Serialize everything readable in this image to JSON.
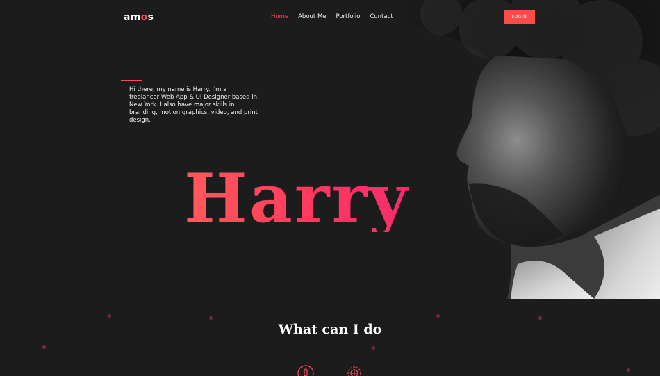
{
  "nav": {
    "logo_prefix": "am",
    "logo_accent": "o",
    "logo_suffix": "s",
    "items": [
      {
        "label": "Home",
        "active": true
      },
      {
        "label": "About Me",
        "active": false
      },
      {
        "label": "Portfolio",
        "active": false
      },
      {
        "label": "Contact",
        "active": false
      }
    ],
    "login_label": "LOGIN"
  },
  "hero": {
    "intro": "Hi there, my name is Harry. I'm a freelancer Web App & UI Designer based in New York. I also have major skills in branding, motion graphics, video, and print design.",
    "name": "Harry"
  },
  "services": {
    "title": "What can I do",
    "icons": [
      "touch-icon",
      "settings-globe-icon"
    ]
  },
  "colors": {
    "accent": "#ff4a5d",
    "background": "#1c1c1d"
  }
}
